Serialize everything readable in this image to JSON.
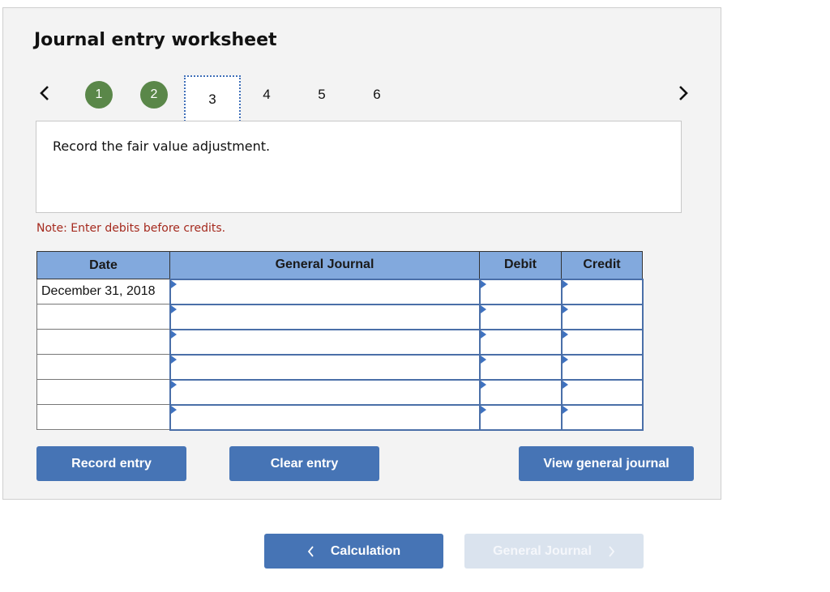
{
  "worksheet": {
    "title": "Journal entry worksheet",
    "prev_icon": "chevron-left-icon",
    "next_icon": "chevron-right-icon",
    "steps": [
      {
        "label": "1",
        "state": "done"
      },
      {
        "label": "2",
        "state": "done"
      },
      {
        "label": "3",
        "state": "current"
      },
      {
        "label": "4",
        "state": "todo"
      },
      {
        "label": "5",
        "state": "todo"
      },
      {
        "label": "6",
        "state": "todo"
      }
    ],
    "prompt": "Record the fair value adjustment.",
    "note": "Note: Enter debits before credits."
  },
  "journal": {
    "headers": {
      "date": "Date",
      "general_journal": "General Journal",
      "debit": "Debit",
      "credit": "Credit"
    },
    "rows": [
      {
        "date": "December 31, 2018",
        "account": "",
        "debit": "",
        "credit": ""
      },
      {
        "date": "",
        "account": "",
        "debit": "",
        "credit": ""
      },
      {
        "date": "",
        "account": "",
        "debit": "",
        "credit": ""
      },
      {
        "date": "",
        "account": "",
        "debit": "",
        "credit": ""
      },
      {
        "date": "",
        "account": "",
        "debit": "",
        "credit": ""
      },
      {
        "date": "",
        "account": "",
        "debit": "",
        "credit": ""
      }
    ]
  },
  "actions": {
    "record_entry": "Record entry",
    "clear_entry": "Clear entry",
    "view_general_journal": "View general journal"
  },
  "footer_nav": {
    "prev_label": "Calculation",
    "next_label": "General Journal",
    "next_disabled": true
  },
  "colors": {
    "step_done": "#5a8749",
    "header_bg": "#82a9dd",
    "button_bg": "#4674b5",
    "button_disabled_bg": "#dae3ee",
    "note_text": "#a52a1e"
  }
}
